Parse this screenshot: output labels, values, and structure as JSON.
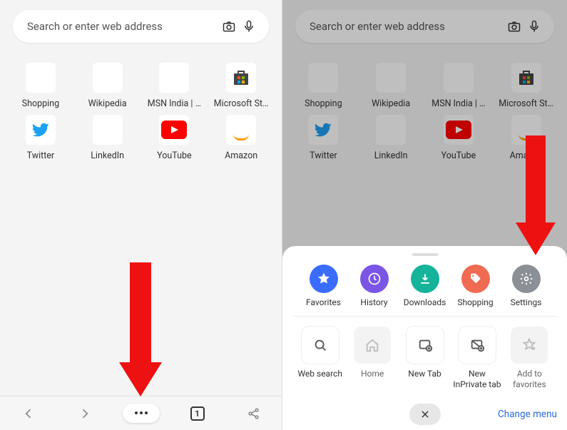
{
  "search": {
    "placeholder": "Search or enter web address"
  },
  "tiles": [
    {
      "key": "shopping",
      "label": "Shopping",
      "icon": "tag-icon"
    },
    {
      "key": "wikipedia",
      "label": "Wikipedia",
      "icon": "wikipedia-icon"
    },
    {
      "key": "msn",
      "label": "MSN India | …",
      "icon": "msn-icon"
    },
    {
      "key": "ms",
      "label": "Microsoft St…",
      "icon": "microsoft-store-icon"
    },
    {
      "key": "twitter",
      "label": "Twitter",
      "icon": "twitter-icon"
    },
    {
      "key": "linkedin",
      "label": "LinkedIn",
      "icon": "linkedin-icon"
    },
    {
      "key": "youtube",
      "label": "YouTube",
      "icon": "youtube-icon"
    },
    {
      "key": "amazon",
      "label": "Amazon",
      "icon": "amazon-icon"
    }
  ],
  "bottomnav": {
    "tab_count": "1"
  },
  "sheet": {
    "quick": [
      {
        "key": "favorites",
        "label": "Favorites",
        "color": "c-fav",
        "icon": "star-icon"
      },
      {
        "key": "history",
        "label": "History",
        "color": "c-his",
        "icon": "history-icon"
      },
      {
        "key": "downloads",
        "label": "Downloads",
        "color": "c-dl",
        "icon": "download-icon"
      },
      {
        "key": "shopping",
        "label": "Shopping",
        "color": "c-shop",
        "icon": "tag-icon"
      },
      {
        "key": "settings",
        "label": "Settings",
        "color": "c-set",
        "icon": "gear-icon"
      }
    ],
    "actions": [
      {
        "key": "websearch",
        "label": "Web search",
        "icon": "search-icon",
        "active": true
      },
      {
        "key": "home",
        "label": "Home",
        "icon": "home-icon",
        "active": false
      },
      {
        "key": "newtab",
        "label": "New Tab",
        "icon": "newtab-icon",
        "active": true
      },
      {
        "key": "inprivate",
        "label": "New InPrivate tab",
        "icon": "inprivate-icon",
        "active": true
      },
      {
        "key": "addfav",
        "label": "Add to favorites",
        "icon": "star-add-icon",
        "active": false
      }
    ],
    "change_menu": "Change menu"
  },
  "colors": {
    "accent_blue": "#2a6bd6",
    "arrow_red": "#e11",
    "shopping": "#ef6b51"
  }
}
